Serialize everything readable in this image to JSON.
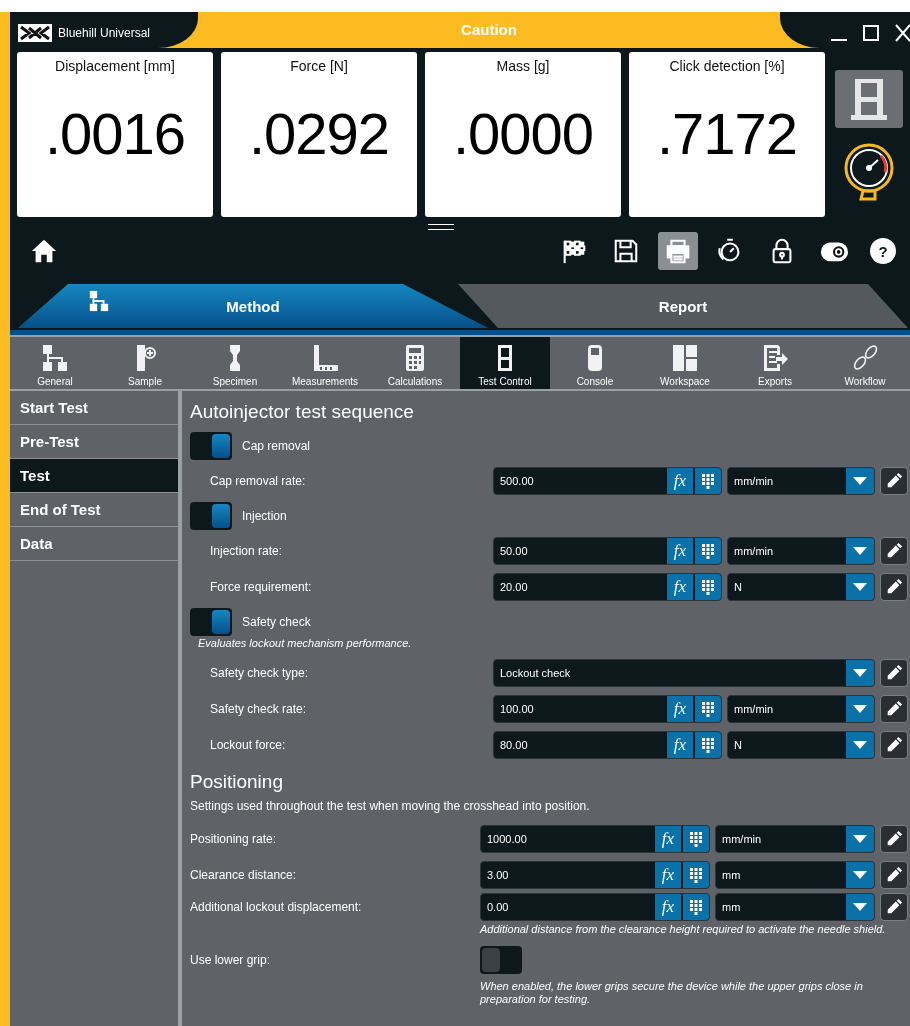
{
  "window": {
    "app_name": "Bluehill Universal",
    "title": "Caution"
  },
  "readouts": [
    {
      "label": "Displacement [mm]",
      "value": ".0016"
    },
    {
      "label": "Force [N]",
      "value": ".0292"
    },
    {
      "label": "Mass [g]",
      "value": ".0000"
    },
    {
      "label": "Click detection [%]",
      "value": ".7172"
    }
  ],
  "toolbar": {
    "items": [
      {
        "kind": "flag",
        "selected": false
      },
      {
        "kind": "save",
        "selected": false
      },
      {
        "kind": "print",
        "selected": true
      },
      {
        "kind": "timer",
        "selected": false
      },
      {
        "kind": "lock",
        "selected": false
      },
      {
        "kind": "eye",
        "selected": false
      },
      {
        "kind": "help",
        "label": "?",
        "selected": false
      }
    ]
  },
  "tabs": [
    {
      "label": "Method",
      "selected": true
    },
    {
      "label": "Report",
      "selected": false
    }
  ],
  "nav": [
    {
      "kind": "general",
      "label": "General",
      "selected": false
    },
    {
      "kind": "sample",
      "label": "Sample",
      "selected": false
    },
    {
      "kind": "specimen",
      "label": "Specimen",
      "selected": false
    },
    {
      "kind": "measurements",
      "label": "Measurements",
      "selected": false
    },
    {
      "kind": "calculations",
      "label": "Calculations",
      "selected": false
    },
    {
      "kind": "testcontrol",
      "label": "Test Control",
      "selected": true
    },
    {
      "kind": "console",
      "label": "Console",
      "selected": false
    },
    {
      "kind": "workspace",
      "label": "Workspace",
      "selected": false
    },
    {
      "kind": "exports",
      "label": "Exports",
      "selected": false
    },
    {
      "kind": "workflow",
      "label": "Workflow",
      "selected": false
    }
  ],
  "sidebar": {
    "items": [
      {
        "label": "Start Test",
        "selected": false
      },
      {
        "label": "Pre-Test",
        "selected": false
      },
      {
        "label": "Test",
        "selected": true
      },
      {
        "label": "End of Test",
        "selected": false
      },
      {
        "label": "Data",
        "selected": false
      }
    ]
  },
  "sections": [
    {
      "title": "Autoinjector test sequence",
      "rows": [
        {
          "kind": "toggle",
          "label": "Cap removal",
          "on": true
        },
        {
          "kind": "number",
          "label": "Cap removal rate:",
          "value": "500.00",
          "fx": "fx",
          "unit": "mm/min"
        },
        {
          "kind": "toggle",
          "label": "Injection",
          "on": true
        },
        {
          "kind": "number",
          "label": "Injection rate:",
          "value": "50.00",
          "fx": "fx",
          "unit": "mm/min"
        },
        {
          "kind": "number",
          "label": "Force requirement:",
          "value": "20.00",
          "fx": "fx",
          "unit": "N"
        },
        {
          "kind": "toggle",
          "label": "Safety check",
          "on": true
        },
        {
          "kind": "note",
          "text": "Evaluates lockout mechanism performance."
        },
        {
          "kind": "select",
          "label": "Safety check type:",
          "value": "Lockout check"
        },
        {
          "kind": "number",
          "label": "Safety check rate:",
          "value": "100.00",
          "fx": "fx",
          "unit": "mm/min"
        },
        {
          "kind": "number",
          "label": "Lockout force:",
          "value": "80.00",
          "fx": "fx",
          "unit": "N"
        }
      ]
    },
    {
      "title": "Positioning",
      "description": "Settings used throughout the test when moving the crosshead into position.",
      "rows": [
        {
          "kind": "number",
          "label": "Positioning rate:",
          "value": "1000.00",
          "fx": "fx",
          "unit": "mm/min"
        },
        {
          "kind": "number",
          "label": "Clearance distance:",
          "value": "3.00",
          "fx": "fx",
          "unit": "mm"
        },
        {
          "kind": "number",
          "label": "Additional lockout displacement:",
          "value": "0.00",
          "fx": "fx",
          "unit": "mm",
          "hint": "Additional distance from the clearance height required to activate the needle shield."
        },
        {
          "kind": "switch",
          "label": "Use lower grip:",
          "on": false,
          "hint": "When enabled, the lower grips secure the device while the upper grips close in preparation for testing."
        }
      ]
    }
  ]
}
